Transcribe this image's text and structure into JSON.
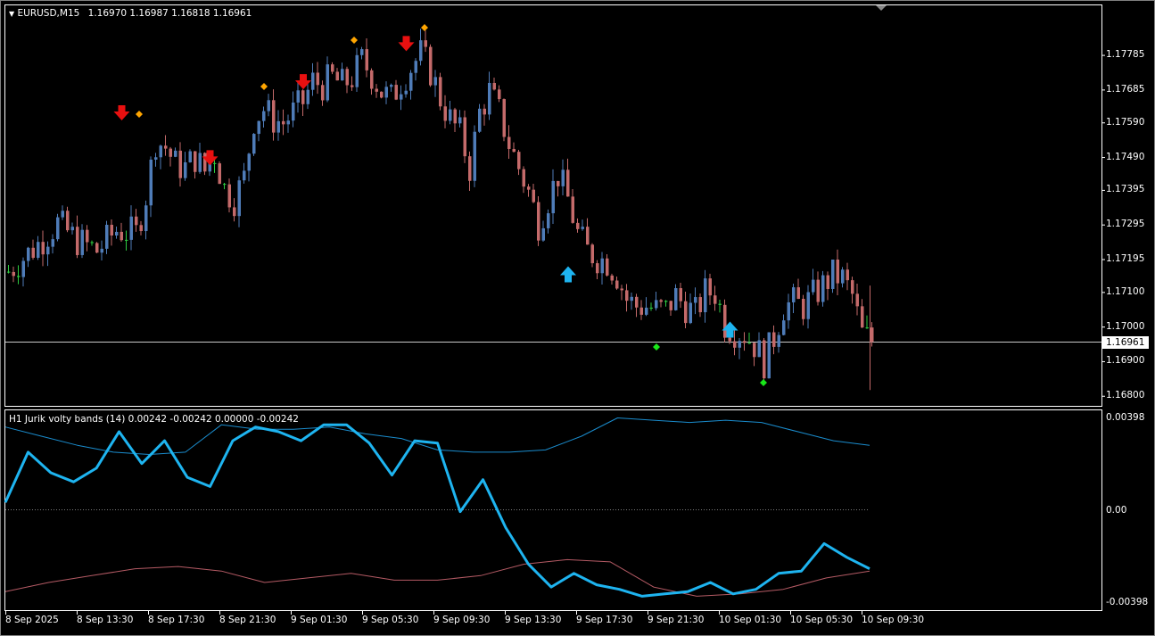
{
  "header": {
    "symbol_tf": "EURUSD,M15",
    "ohlc": "1.16970 1.16987 1.16818 1.16961"
  },
  "indicator": {
    "title": "H1 Jurik volty bands (14) 0.00242 -0.00242 0.00000 -0.00242"
  },
  "price_axis": [
    "1.17785",
    "1.17685",
    "1.17590",
    "1.17490",
    "1.17395",
    "1.17295",
    "1.17195",
    "1.17100",
    "1.17000",
    "1.16900",
    "1.16800"
  ],
  "current_price": "1.16961",
  "indicator_axis": [
    "0.00398",
    "0.00",
    "-0.00398"
  ],
  "time_axis": [
    "8 Sep 2025",
    "8 Sep 13:30",
    "8 Sep 17:30",
    "8 Sep 21:30",
    "9 Sep 01:30",
    "9 Sep 05:30",
    "9 Sep 09:30",
    "9 Sep 13:30",
    "9 Sep 17:30",
    "9 Sep 21:30",
    "10 Sep 01:30",
    "10 Sep 05:30",
    "10 Sep 09:30"
  ],
  "colors": {
    "bull": "#4f7cb8",
    "bear": "#c46a6a",
    "doji": "#2ecc40",
    "arrow_down": "#e81010",
    "arrow_up": "#1eb4f0",
    "diamond_top": "#ffa500",
    "diamond_bottom": "#19e619",
    "main_line": "#1eb4f0",
    "upper_band": "#1a8ccd",
    "lower_band": "#b45a64",
    "grid": "#ffffff"
  },
  "chart_data": [
    {
      "type": "candlestick",
      "symbol": "EURUSD",
      "timeframe": "M15",
      "ylim": [
        1.1678,
        1.1786
      ],
      "close_path": [
        [
          0,
          1.1716
        ],
        [
          6,
          1.1724
        ],
        [
          10,
          1.173
        ],
        [
          14,
          1.1725
        ],
        [
          18,
          1.1722
        ],
        [
          22,
          1.1728
        ],
        [
          26,
          1.1727
        ],
        [
          28,
          1.1738
        ],
        [
          30,
          1.1754
        ],
        [
          32,
          1.1752
        ],
        [
          34,
          1.1747
        ],
        [
          36,
          1.1746
        ],
        [
          38,
          1.1749
        ],
        [
          40,
          1.1745
        ],
        [
          42,
          1.175
        ],
        [
          44,
          1.174
        ],
        [
          46,
          1.1737
        ],
        [
          48,
          1.1743
        ],
        [
          50,
          1.176
        ],
        [
          52,
          1.1763
        ],
        [
          54,
          1.176
        ],
        [
          56,
          1.1759
        ],
        [
          58,
          1.1762
        ],
        [
          60,
          1.1765
        ],
        [
          62,
          1.1771
        ],
        [
          64,
          1.177
        ],
        [
          66,
          1.1772
        ],
        [
          68,
          1.177
        ],
        [
          70,
          1.1772
        ],
        [
          72,
          1.1777
        ],
        [
          74,
          1.1773
        ],
        [
          76,
          1.1768
        ],
        [
          78,
          1.1766
        ],
        [
          80,
          1.1771
        ],
        [
          82,
          1.1775
        ],
        [
          84,
          1.1779
        ],
        [
          86,
          1.1774
        ],
        [
          88,
          1.1766
        ],
        [
          90,
          1.176
        ],
        [
          92,
          1.1756
        ],
        [
          94,
          1.1746
        ],
        [
          96,
          1.1762
        ],
        [
          98,
          1.1768
        ],
        [
          100,
          1.1762
        ],
        [
          102,
          1.1753
        ],
        [
          104,
          1.1746
        ],
        [
          106,
          1.1739
        ],
        [
          108,
          1.173
        ],
        [
          110,
          1.1737
        ],
        [
          112,
          1.1744
        ],
        [
          114,
          1.1737
        ],
        [
          116,
          1.1727
        ],
        [
          118,
          1.1722
        ],
        [
          120,
          1.172
        ],
        [
          122,
          1.1719
        ],
        [
          124,
          1.1715
        ],
        [
          126,
          1.1708
        ],
        [
          128,
          1.1706
        ],
        [
          130,
          1.1706
        ],
        [
          132,
          1.1705
        ],
        [
          134,
          1.1705
        ],
        [
          136,
          1.1709
        ],
        [
          138,
          1.1706
        ],
        [
          140,
          1.1704
        ],
        [
          142,
          1.171
        ],
        [
          144,
          1.171
        ],
        [
          146,
          1.1701
        ],
        [
          148,
          1.1699
        ],
        [
          150,
          1.1698
        ],
        [
          152,
          1.1695
        ],
        [
          154,
          1.169
        ],
        [
          156,
          1.1697
        ],
        [
          158,
          1.1706
        ],
        [
          160,
          1.1707
        ],
        [
          162,
          1.1706
        ],
        [
          164,
          1.1709
        ],
        [
          166,
          1.1712
        ],
        [
          168,
          1.1715
        ],
        [
          170,
          1.1714
        ],
        [
          172,
          1.1709
        ],
        [
          174,
          1.1698
        ],
        [
          176,
          1.1696
        ]
      ],
      "signals": [
        {
          "kind": "sell-arrow",
          "price": 1.1761
        },
        {
          "kind": "sell-arrow",
          "price": 1.1748
        },
        {
          "kind": "sell-arrow",
          "price": 1.177
        },
        {
          "kind": "sell-arrow",
          "price": 1.1781
        },
        {
          "kind": "buy-arrow",
          "price": 1.1715
        },
        {
          "kind": "buy-arrow",
          "price": 1.1699
        }
      ],
      "current_price": 1.16961
    },
    {
      "type": "line",
      "title": "H1 Jurik volty bands (14) 0.00242 -0.00242 0.00000 -0.00242",
      "ylim": [
        -0.00398,
        0.00398
      ],
      "zero_line": 0,
      "series": [
        {
          "role": "main",
          "values": [
            0.0003,
            0.0025,
            0.0016,
            0.0012,
            0.0018,
            0.0034,
            0.002,
            0.003,
            0.0014,
            0.001,
            0.003,
            0.0036,
            0.0034,
            0.003,
            0.0037,
            0.0037,
            0.0029,
            0.0015,
            0.003,
            0.0029,
            -0.0001,
            0.0013,
            -0.0008,
            -0.0024,
            -0.0034,
            -0.0028,
            -0.0033,
            -0.0035,
            -0.0038,
            -0.0037,
            -0.0036,
            -0.0032,
            -0.0037,
            -0.0035,
            -0.0028,
            -0.0027,
            -0.0015,
            -0.0021,
            -0.0026
          ]
        },
        {
          "role": "upper_band",
          "values": [
            0.0036,
            0.0032,
            0.0028,
            0.0025,
            0.0024,
            0.0025,
            0.0037,
            0.0035,
            0.0035,
            0.0036,
            0.0033,
            0.0031,
            0.0026,
            0.0025,
            0.0025,
            0.0026,
            0.0032,
            0.004,
            0.0039,
            0.0038,
            0.0039,
            0.0038,
            0.0034,
            0.003,
            0.0028
          ]
        },
        {
          "role": "lower_band",
          "values": [
            -0.0036,
            -0.0032,
            -0.0029,
            -0.0026,
            -0.0025,
            -0.0027,
            -0.0032,
            -0.003,
            -0.0028,
            -0.0031,
            -0.0031,
            -0.0029,
            -0.0024,
            -0.0022,
            -0.0023,
            -0.0034,
            -0.0038,
            -0.0037,
            -0.0035,
            -0.003,
            -0.0027
          ]
        }
      ]
    }
  ]
}
